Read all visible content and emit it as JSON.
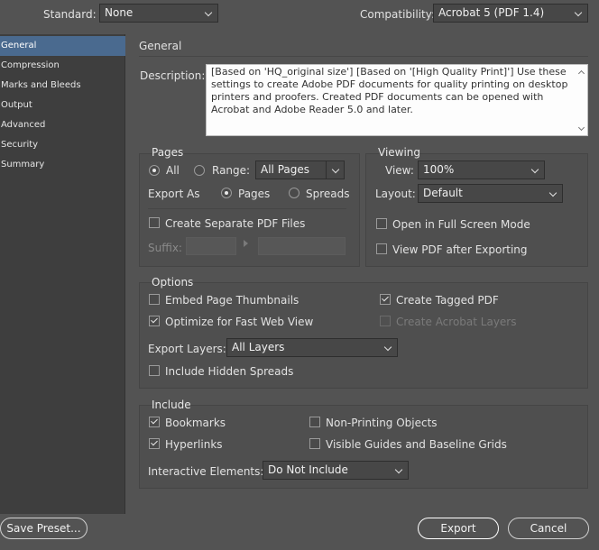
{
  "header": {
    "standard_label": "Standard:",
    "standard_value": "None",
    "compat_label": "Compatibility:",
    "compat_value": "Acrobat 5 (PDF 1.4)"
  },
  "sidebar": {
    "items": [
      {
        "label": "General",
        "selected": true
      },
      {
        "label": "Compression"
      },
      {
        "label": "Marks and Bleeds"
      },
      {
        "label": "Output"
      },
      {
        "label": "Advanced"
      },
      {
        "label": "Security"
      },
      {
        "label": "Summary"
      }
    ]
  },
  "section_title": "General",
  "description": {
    "label": "Description:",
    "text": "[Based on 'HQ_original size'] [Based on '[High Quality Print]'] Use these settings to create Adobe PDF documents for quality printing on desktop printers and proofers.  Created PDF documents can be opened with Acrobat and Adobe Reader 5.0 and later."
  },
  "pages": {
    "title": "Pages",
    "all_label": "All",
    "range_label": "Range:",
    "range_value": "All Pages",
    "export_as_label": "Export As",
    "pages_label": "Pages",
    "spreads_label": "Spreads",
    "separate_label": "Create Separate PDF Files",
    "suffix_label": "Suffix:"
  },
  "viewing": {
    "title": "Viewing",
    "view_label": "View:",
    "view_value": "100%",
    "layout_label": "Layout:",
    "layout_value": "Default",
    "fullscreen_label": "Open in Full Screen Mode",
    "view_after_label": "View PDF after Exporting"
  },
  "options": {
    "title": "Options",
    "embed_thumbs": "Embed Page Thumbnails",
    "optimize_web": "Optimize for Fast Web View",
    "tagged_pdf": "Create Tagged PDF",
    "acrobat_layers": "Create Acrobat Layers",
    "export_layers_label": "Export Layers:",
    "export_layers_value": "All Layers",
    "hidden_spreads": "Include Hidden Spreads"
  },
  "include": {
    "title": "Include",
    "bookmarks": "Bookmarks",
    "hyperlinks": "Hyperlinks",
    "non_printing": "Non-Printing Objects",
    "guides": "Visible Guides and Baseline Grids",
    "interactive_label": "Interactive Elements:",
    "interactive_value": "Do Not Include"
  },
  "footer": {
    "save_preset": "Save Preset...",
    "export": "Export",
    "cancel": "Cancel"
  }
}
